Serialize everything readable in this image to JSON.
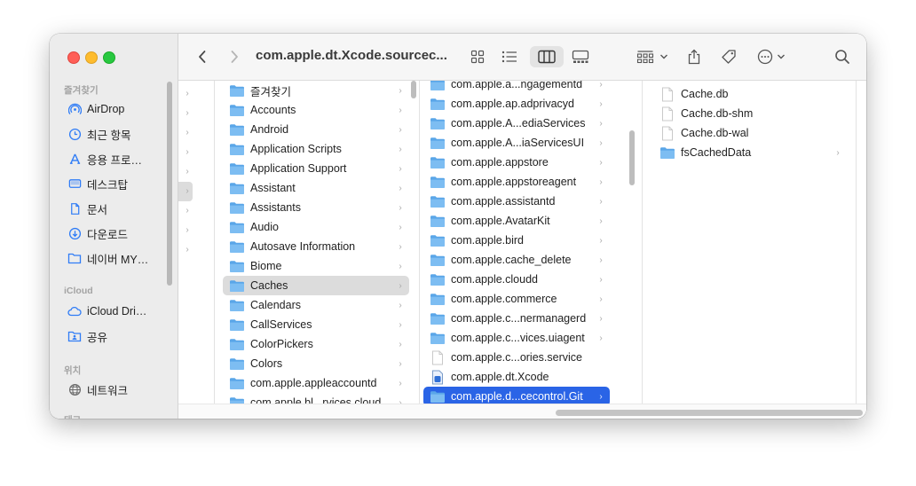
{
  "window": {
    "title": "com.apple.dt.Xcode.sourcec..."
  },
  "sidebar": {
    "favorites_header": "즐겨찾기",
    "icloud_header": "iCloud",
    "locations_header": "위치",
    "tags_header": "태그",
    "favorites": [
      {
        "label": "AirDrop",
        "icon": "airdrop-icon"
      },
      {
        "label": "최근 항목",
        "icon": "clock-icon"
      },
      {
        "label": "응용 프로…",
        "icon": "applications-icon"
      },
      {
        "label": "데스크탑",
        "icon": "desktop-icon"
      },
      {
        "label": "문서",
        "icon": "document-icon"
      },
      {
        "label": "다운로드",
        "icon": "download-icon"
      },
      {
        "label": "네이버 MY…",
        "icon": "folder-icon"
      }
    ],
    "icloud": [
      {
        "label": "iCloud Dri…",
        "icon": "cloud-icon"
      },
      {
        "label": "공유",
        "icon": "shared-folder-icon"
      }
    ],
    "locations": [
      {
        "label": "네트워크",
        "icon": "network-icon"
      }
    ]
  },
  "columns": {
    "col1": [
      {
        "name": "즐겨찾기"
      },
      {
        "name": "Accounts"
      },
      {
        "name": "Android"
      },
      {
        "name": "Application Scripts"
      },
      {
        "name": "Application Support"
      },
      {
        "name": "Assistant"
      },
      {
        "name": "Assistants"
      },
      {
        "name": "Audio"
      },
      {
        "name": "Autosave Information"
      },
      {
        "name": "Biome"
      },
      {
        "name": "Caches"
      },
      {
        "name": "Calendars"
      },
      {
        "name": "CallServices"
      },
      {
        "name": "ColorPickers"
      },
      {
        "name": "Colors"
      },
      {
        "name": "com.apple.appleaccountd"
      },
      {
        "name": "com.apple.bl...rvices.cloud"
      }
    ],
    "col2": [
      {
        "name": "com.apple.a...ngagementd"
      },
      {
        "name": "com.apple.ap.adprivacyd"
      },
      {
        "name": "com.apple.A...ediaServices"
      },
      {
        "name": "com.apple.A...iaServicesUI"
      },
      {
        "name": "com.apple.appstore"
      },
      {
        "name": "com.apple.appstoreagent"
      },
      {
        "name": "com.apple.assistantd"
      },
      {
        "name": "com.apple.AvatarKit"
      },
      {
        "name": "com.apple.bird"
      },
      {
        "name": "com.apple.cache_delete"
      },
      {
        "name": "com.apple.cloudd"
      },
      {
        "name": "com.apple.commerce"
      },
      {
        "name": "com.apple.c...nermanagerd"
      },
      {
        "name": "com.apple.c...vices.uiagent"
      },
      {
        "name": "com.apple.c...ories.service"
      },
      {
        "name": "com.apple.dt.Xcode"
      },
      {
        "name": "com.apple.d...cecontrol.Git"
      }
    ],
    "col3": [
      {
        "name": "Cache.db"
      },
      {
        "name": "Cache.db-shm"
      },
      {
        "name": "Cache.db-wal"
      },
      {
        "name": "fsCachedData"
      }
    ]
  },
  "colors": {
    "selection": "#2a64e6",
    "folder": "#5aa6e8"
  }
}
